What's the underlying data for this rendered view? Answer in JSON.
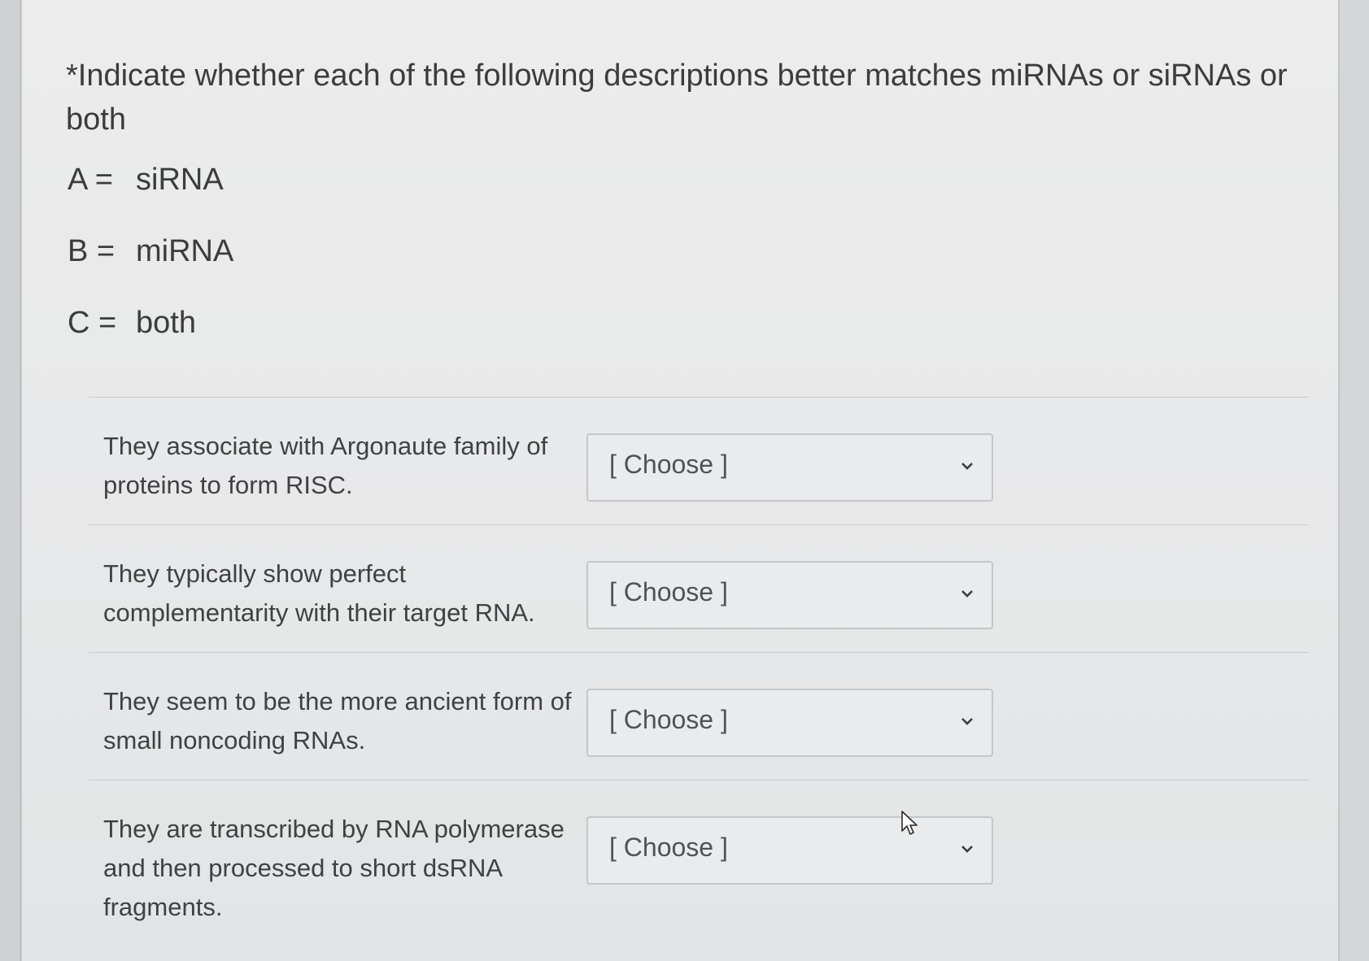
{
  "question": {
    "text": "*Indicate whether each of the following descriptions better matches miRNAs or siRNAs  or both"
  },
  "key": [
    {
      "letter": "A =",
      "meaning": "siRNA"
    },
    {
      "letter": "B =",
      "meaning": "miRNA"
    },
    {
      "letter": "C =",
      "meaning": "both"
    }
  ],
  "items": [
    {
      "description": "They associate with Argonaute family of proteins to form RISC.",
      "selected": "[ Choose ]"
    },
    {
      "description": "They typically show perfect complementarity with their target RNA.",
      "selected": "[ Choose ]"
    },
    {
      "description": "They seem to be the more ancient form of small noncoding RNAs.",
      "selected": "[ Choose ]"
    },
    {
      "description": "They are transcribed by RNA polymerase and then processed to short dsRNA fragments.",
      "selected": "[ Choose ]"
    }
  ],
  "icons": {
    "dropdown": "chevron-down-icon",
    "pointer": "mouse-cursor-icon"
  },
  "colors": {
    "text": "#3a3c3e",
    "border": "#c4c7ca"
  }
}
